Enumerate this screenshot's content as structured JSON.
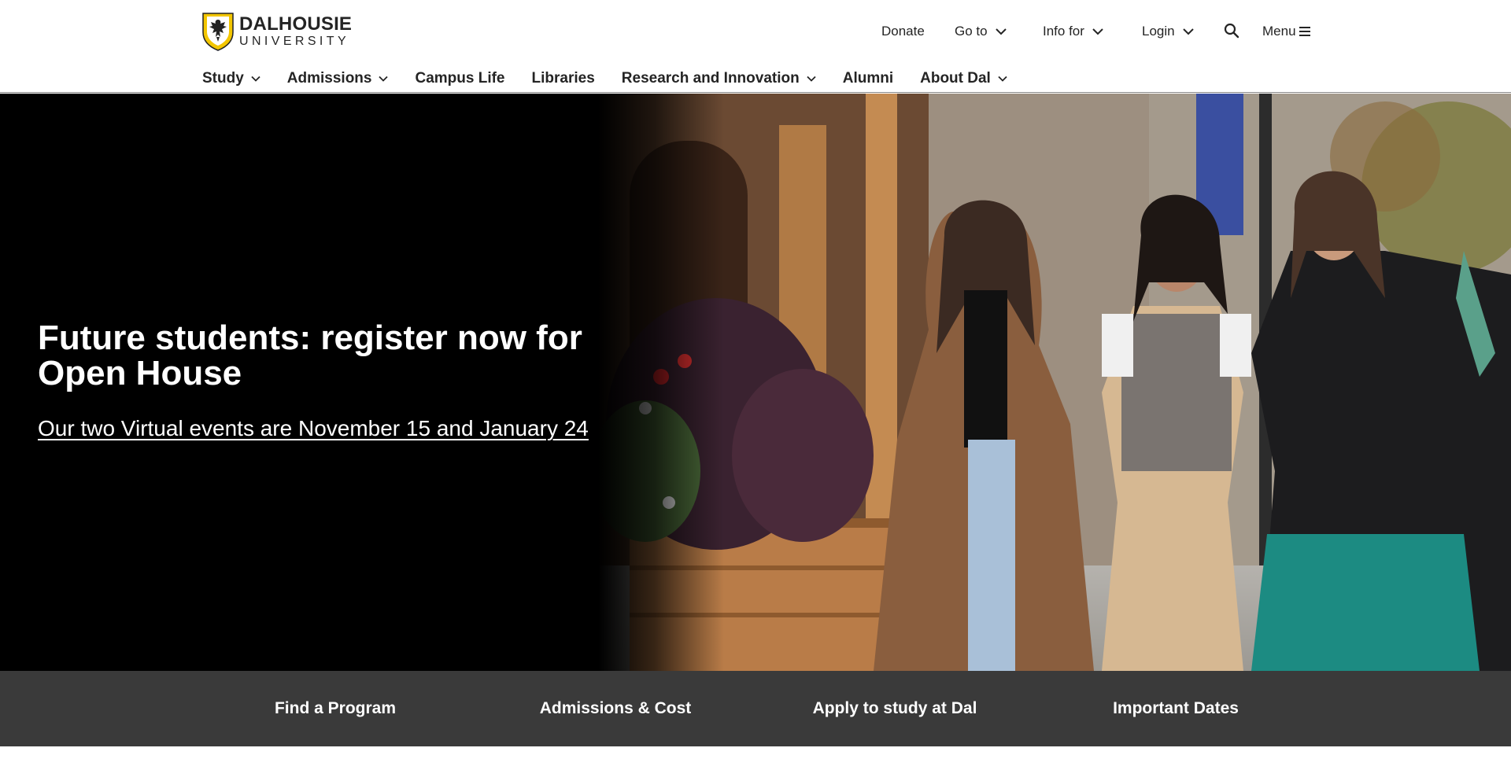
{
  "brand": {
    "name": "DALHOUSIE",
    "sub": "UNIVERSITY"
  },
  "utility": {
    "donate": "Donate",
    "goto": "Go to",
    "info_for": "Info for",
    "login": "Login",
    "search_icon": "search-icon",
    "menu": "Menu"
  },
  "nav": {
    "items": [
      {
        "label": "Study",
        "has_dropdown": true
      },
      {
        "label": "Admissions",
        "has_dropdown": true
      },
      {
        "label": "Campus Life",
        "has_dropdown": false
      },
      {
        "label": "Libraries",
        "has_dropdown": false
      },
      {
        "label": "Research and Innovation",
        "has_dropdown": true
      },
      {
        "label": "Alumni",
        "has_dropdown": false
      },
      {
        "label": "About Dal",
        "has_dropdown": true
      }
    ]
  },
  "hero": {
    "title": "Future students: register now for Open House",
    "link": "Our two Virtual events are November 15 and January 24"
  },
  "quick_links": {
    "items": [
      {
        "label": "Find a Program"
      },
      {
        "label": "Admissions & Cost"
      },
      {
        "label": "Apply to study at Dal"
      },
      {
        "label": "Important Dates"
      }
    ]
  },
  "colors": {
    "brand_gold": "#f3c600",
    "quick_bar": "#3a3a3a",
    "hero_bg": "#000000",
    "text_dark": "#242424"
  }
}
